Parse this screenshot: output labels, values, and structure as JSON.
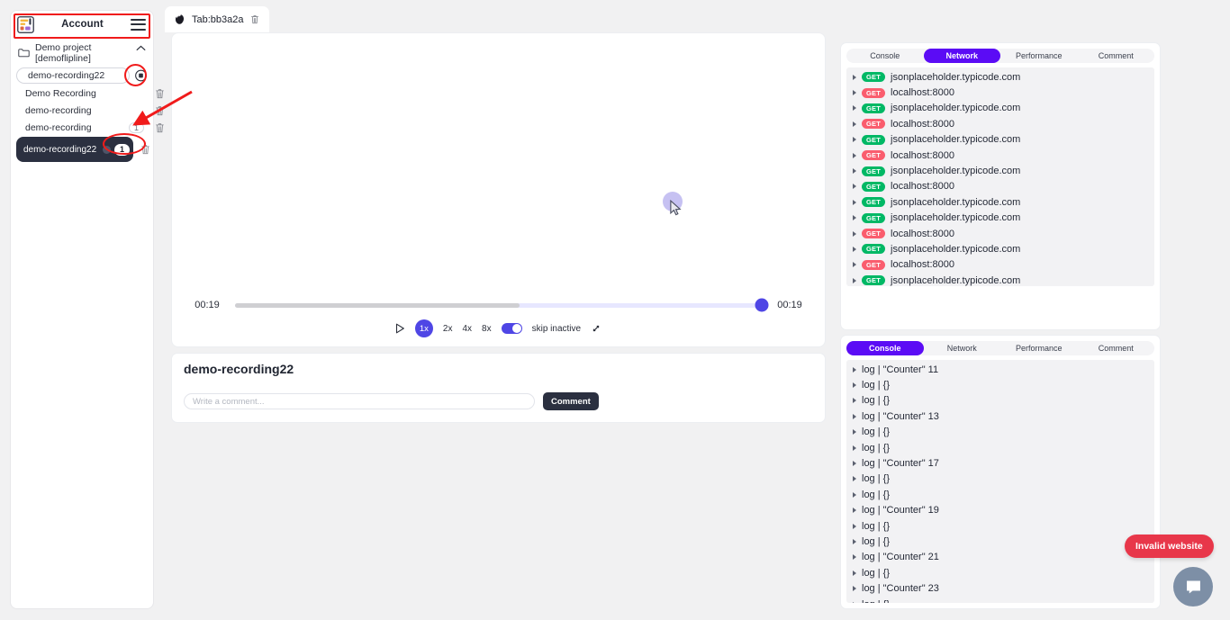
{
  "sidebar": {
    "logo_icon": "account-logo-icon",
    "title": "Account",
    "menu_icon": "hamburger-menu-icon",
    "project": {
      "folder_icon": "folder-icon",
      "name": "Demo project [demoflipline]",
      "collapse_icon": "chevron-up-icon"
    },
    "recordings": [
      {
        "label": "demo-recording22",
        "style": "pill",
        "action_icon": "record-target-icon",
        "count": "",
        "selected": false
      },
      {
        "label": "Demo Recording",
        "style": "plain",
        "action_icon": "trash-icon",
        "count": "",
        "selected": false
      },
      {
        "label": "demo-recording",
        "style": "plain",
        "action_icon": "trash-icon",
        "count": "",
        "selected": false
      },
      {
        "label": "demo-recording",
        "style": "plain",
        "action_icon": "trash-icon",
        "count": "1",
        "selected": false
      },
      {
        "label": "demo-recording22",
        "style": "dark",
        "action_icon": "trash-icon",
        "count": "1",
        "selected": true
      }
    ]
  },
  "tabbar": {
    "tab": {
      "browser_icon": "firefox-icon",
      "label": "Tab:bb3a2a",
      "close_icon": "trash-icon"
    }
  },
  "player": {
    "cursor_icon": "mouse-cursor-icon",
    "current_time": "00:19",
    "total_time": "00:19",
    "progress_percent": 100,
    "buffered_percent": 54,
    "controls": {
      "play_icon": "play-icon",
      "speeds": [
        "1x",
        "2x",
        "4x",
        "8x"
      ],
      "active_speed": "1x",
      "skip_inactive_label": "skip inactive",
      "skip_inactive_on": true,
      "fullscreen_icon": "expand-arrows-icon"
    }
  },
  "comment_card": {
    "title": "demo-recording22",
    "input_placeholder": "Write a comment...",
    "input_value": "",
    "button_label": "Comment"
  },
  "network_panel": {
    "tabs": [
      "Console",
      "Network",
      "Performance",
      "Comment"
    ],
    "active_tab": "Network",
    "rows": [
      {
        "method": "GET",
        "status": "ok",
        "url": "jsonplaceholder.typicode.com"
      },
      {
        "method": "GET",
        "status": "err",
        "url": "localhost:8000"
      },
      {
        "method": "GET",
        "status": "ok",
        "url": "jsonplaceholder.typicode.com"
      },
      {
        "method": "GET",
        "status": "err",
        "url": "localhost:8000"
      },
      {
        "method": "GET",
        "status": "ok",
        "url": "jsonplaceholder.typicode.com"
      },
      {
        "method": "GET",
        "status": "err",
        "url": "localhost:8000"
      },
      {
        "method": "GET",
        "status": "ok",
        "url": "jsonplaceholder.typicode.com"
      },
      {
        "method": "GET",
        "status": "ok",
        "url": "localhost:8000"
      },
      {
        "method": "GET",
        "status": "ok",
        "url": "jsonplaceholder.typicode.com"
      },
      {
        "method": "GET",
        "status": "ok",
        "url": "jsonplaceholder.typicode.com"
      },
      {
        "method": "GET",
        "status": "err",
        "url": "localhost:8000"
      },
      {
        "method": "GET",
        "status": "ok",
        "url": "jsonplaceholder.typicode.com"
      },
      {
        "method": "GET",
        "status": "err",
        "url": "localhost:8000"
      },
      {
        "method": "GET",
        "status": "ok",
        "url": "jsonplaceholder.typicode.com"
      }
    ]
  },
  "console_panel": {
    "tabs": [
      "Console",
      "Network",
      "Performance",
      "Comment"
    ],
    "active_tab": "Console",
    "rows": [
      {
        "text": "log | \"Counter\" 11"
      },
      {
        "text": "log | {}"
      },
      {
        "text": "log | {}"
      },
      {
        "text": "log | \"Counter\" 13"
      },
      {
        "text": "log | {}"
      },
      {
        "text": "log | {}"
      },
      {
        "text": "log | \"Counter\" 17"
      },
      {
        "text": "log | {}"
      },
      {
        "text": "log | {}"
      },
      {
        "text": "log | \"Counter\" 19"
      },
      {
        "text": "log | {}"
      },
      {
        "text": "log | {}"
      },
      {
        "text": "log | \"Counter\" 21"
      },
      {
        "text": "log | {}"
      },
      {
        "text": "log | \"Counter\" 23"
      },
      {
        "text": "log | {}"
      }
    ]
  },
  "floating": {
    "invalid_badge": "Invalid website",
    "chat_icon": "chat-bubble-icon"
  },
  "annotations": {
    "header_box": "red-highlight-box",
    "target_circle": "red-highlight-circle",
    "toggle_circle": "red-highlight-circle",
    "arrow": "red-arrow-pointer"
  },
  "colors": {
    "accent_purple": "#4f46e5",
    "tab_active_purple": "#5b0cf5",
    "method_ok_green": "#00b865",
    "method_err_red": "#fa5d6e",
    "annotation_red": "#f01b1b",
    "invalid_badge_red": "#e8374a",
    "dark_navy": "#2b3040"
  }
}
